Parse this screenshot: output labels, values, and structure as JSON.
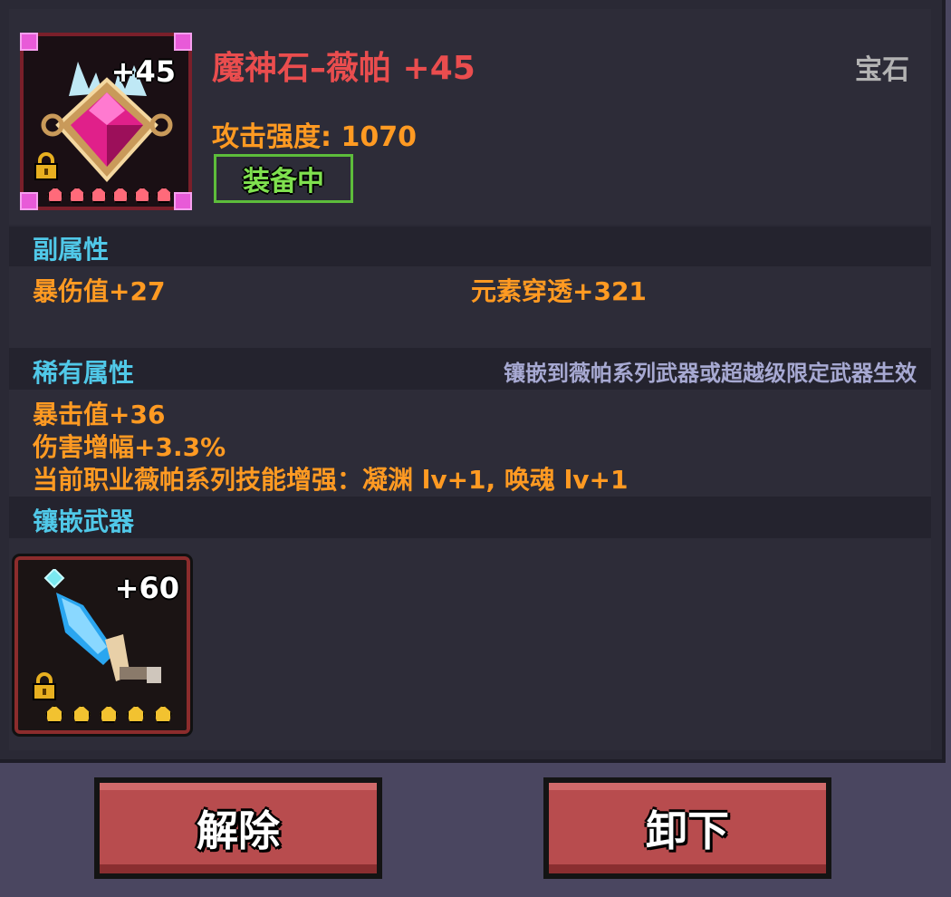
{
  "item": {
    "name": "魔神石–薇帕 +45",
    "type": "宝石",
    "enhance": "+45",
    "attack_label": "攻击强度: 1070",
    "equipped_badge": "装备中",
    "icon": "pink-gem-icon",
    "stars": 6
  },
  "secondary": {
    "title": "副属性",
    "stats": [
      "暴伤值+27",
      "元素穿透+321"
    ]
  },
  "rare": {
    "title": "稀有属性",
    "note": "镶嵌到薇帕系列武器或超越级限定武器生效",
    "stats": [
      "暴击值+36",
      "伤害增幅+3.3%",
      "当前职业薇帕系列技能增强：凝渊 lv+1, 唤魂 lv+1"
    ]
  },
  "socket": {
    "title": "镶嵌武器",
    "weapon_enhance": "+60",
    "weapon_icon": "blue-blade-sword-icon",
    "stars": 5
  },
  "buttons": {
    "remove": "解除",
    "unequip": "卸下"
  },
  "colors": {
    "title_red": "#ea4d4e",
    "stat_orange": "#ff9a22",
    "section_cyan": "#50c8e8",
    "equipped_green": "#7fe04f",
    "button_red": "#b84c4e"
  }
}
